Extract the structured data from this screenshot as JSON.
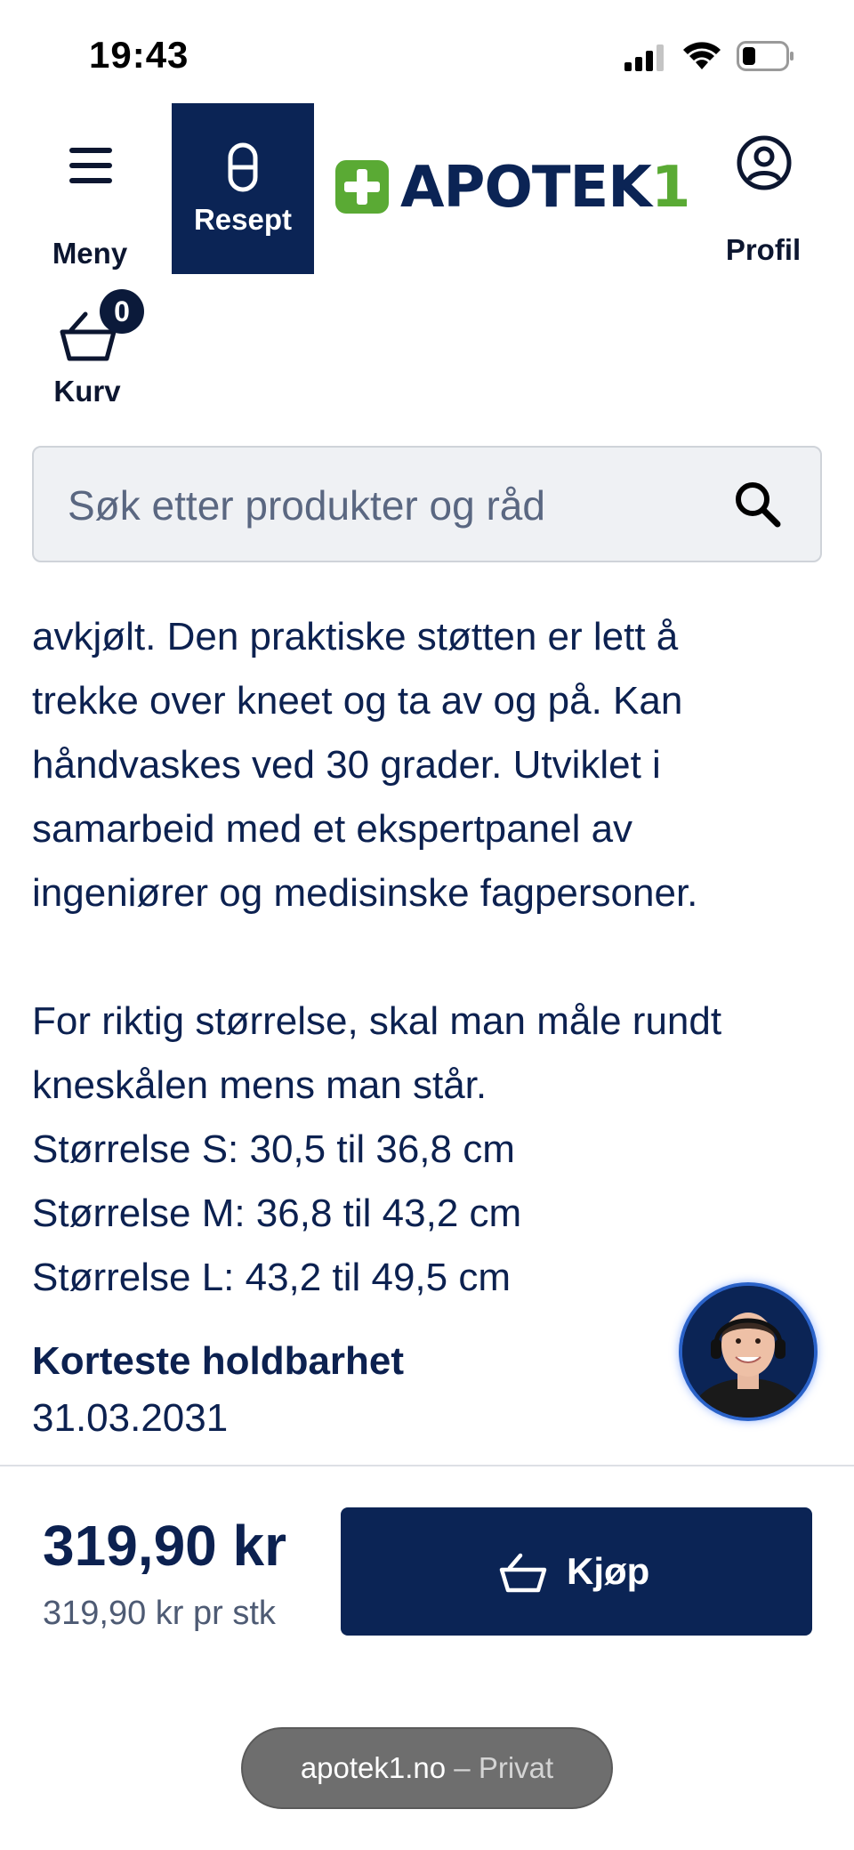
{
  "status_bar": {
    "time": "19:43"
  },
  "header": {
    "menu_label": "Meny",
    "resept_label": "Resept",
    "logo_text": "APOTEK",
    "logo_number": "1",
    "profil_label": "Profil",
    "cart_label": "Kurv",
    "cart_count": "0"
  },
  "search": {
    "placeholder": "Søk etter produkter og råd"
  },
  "description": {
    "lines": [
      "avkjølt. Den praktiske støtten er lett å",
      "trekke over kneet og ta av og på. Kan",
      "håndvaskes ved 30 grader. Utviklet i",
      "samarbeid med et ekspertpanel av",
      "ingeniører og medisinske fagpersoner."
    ],
    "size_lines": [
      "For riktig størrelse, skal man måle rundt",
      "kneskålen mens man står.",
      "Størrelse S: 30,5 til 36,8 cm",
      "Størrelse M: 36,8 til 43,2 cm",
      "Størrelse L: 43,2 til 49,5 cm"
    ]
  },
  "shelf_life": {
    "heading": "Korteste holdbarhet",
    "date": "31.03.2031"
  },
  "purchase": {
    "price": "319,90 kr",
    "unit_price": "319,90 kr pr stk",
    "buy_label": "Kjøp"
  },
  "browser": {
    "domain": "apotek1.no",
    "mode": "– Privat"
  },
  "colors": {
    "brand_navy": "#0b2455",
    "brand_green": "#5aaa34"
  }
}
